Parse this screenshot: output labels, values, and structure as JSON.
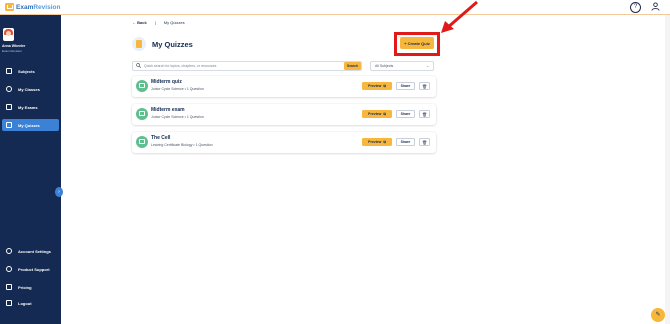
{
  "brand": {
    "name_part1": "Exam",
    "name_part2": "Revision"
  },
  "user": {
    "name": "Anna Wheeler",
    "subtitle": "Exam Revision"
  },
  "sidebar": {
    "items": [
      {
        "label": "Subjects",
        "active": false
      },
      {
        "label": "My Classes",
        "active": false
      },
      {
        "label": "My Exams",
        "active": false
      },
      {
        "label": "My Quizzes",
        "active": true
      }
    ],
    "bottom_items": [
      {
        "label": "Account Settings"
      },
      {
        "label": "Product Support"
      },
      {
        "label": "Pricing"
      },
      {
        "label": "Logout"
      }
    ]
  },
  "breadcrumb": {
    "back_label": "Back",
    "current": "My Quizzes"
  },
  "page": {
    "title": "My Quizzes",
    "create_label": "+ Create Quiz"
  },
  "search": {
    "placeholder": "Quick search for topics, chapters, or resources",
    "button_label": "Search",
    "subject_filter": "All Subjects"
  },
  "quizzes": [
    {
      "title": "Midterm quiz",
      "meta": "Junior Cycle Science • 1 Question",
      "preview": "Preview",
      "share": "Share"
    },
    {
      "title": "Midterm exam",
      "meta": "Junior Cycle Science • 1 Question",
      "preview": "Preview",
      "share": "Share"
    },
    {
      "title": "The Cell",
      "meta": "Leaving Certificate Biology • 1 Question",
      "preview": "Preview",
      "share": "Share"
    }
  ],
  "colors": {
    "sidebar_bg": "#142a52",
    "accent": "#f6b73c",
    "active": "#3b82d6",
    "highlight": "#e01919"
  }
}
